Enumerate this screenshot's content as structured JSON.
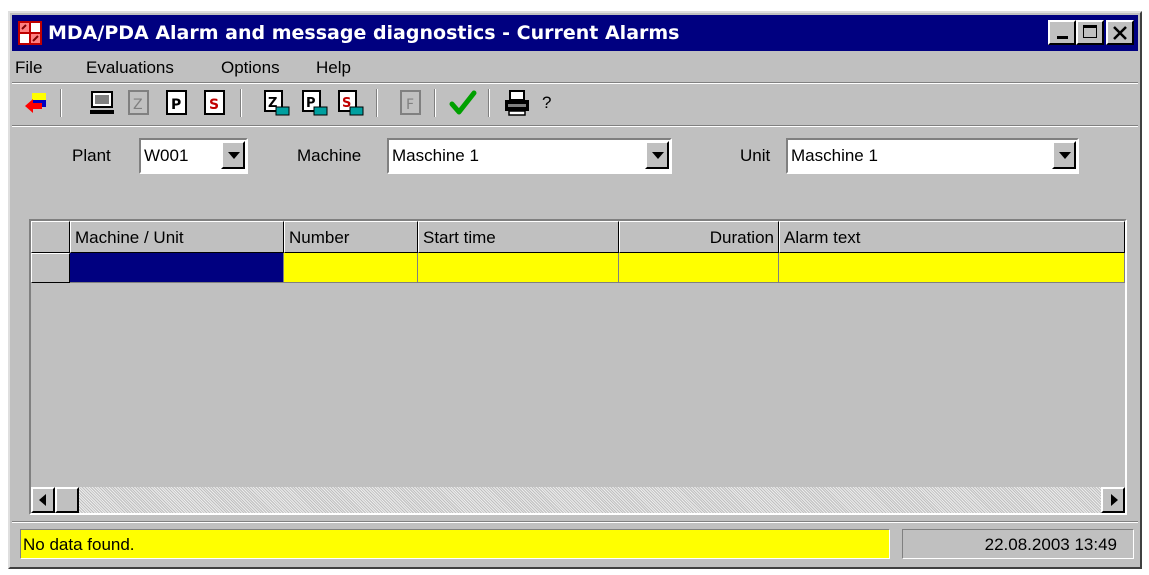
{
  "window": {
    "title": "MDA/PDA Alarm and message diagnostics - Current Alarms"
  },
  "menu": {
    "items": [
      {
        "label": "File"
      },
      {
        "label": "Evaluations"
      },
      {
        "label": "Options"
      },
      {
        "label": "Help"
      }
    ]
  },
  "toolbar": {
    "help_label": "?",
    "icons": [
      "exit-icon",
      "monitor-icon",
      "z-document-icon",
      "p-document-icon",
      "s-document-icon",
      "z-machine-icon",
      "p-machine-icon",
      "s-machine-icon",
      "f-document-icon",
      "checkmark-icon",
      "print-icon"
    ]
  },
  "filters": {
    "plant": {
      "label": "Plant",
      "value": "W001"
    },
    "machine": {
      "label": "Machine",
      "value": "Maschine 1"
    },
    "unit": {
      "label": "Unit",
      "value": "Maschine 1"
    }
  },
  "table": {
    "columns": [
      "Machine / Unit",
      "Number",
      "Start time",
      "Duration",
      "Alarm text"
    ],
    "rows": [
      [
        "",
        "",
        "",
        "",
        ""
      ]
    ]
  },
  "status": {
    "message": "No data found.",
    "datetime": "22.08.2003 13:49"
  },
  "colors": {
    "titlebar": "#000080",
    "face": "#c0c0c0",
    "highlight_row": "#ffff00",
    "selected_cell": "#000080",
    "check": "#00a000"
  }
}
